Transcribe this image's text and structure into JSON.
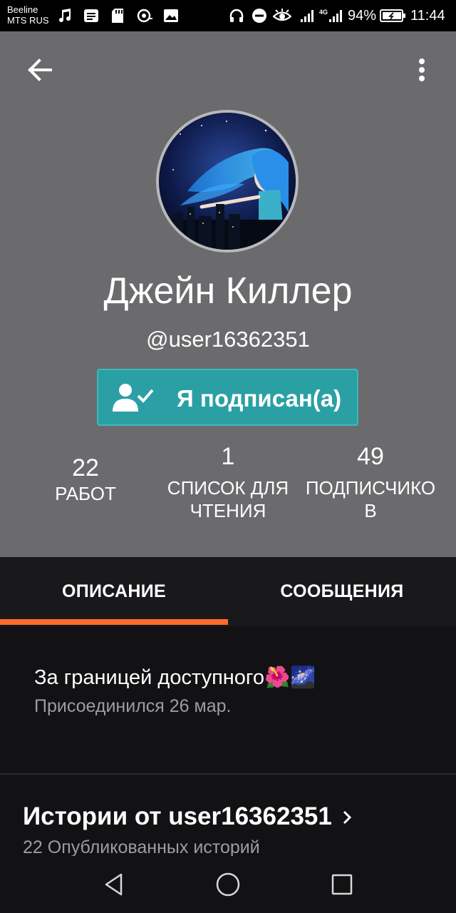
{
  "status_bar": {
    "carrier_line1": "Beeline",
    "carrier_line2": "MTS RUS",
    "battery": "94%",
    "time": "11:44",
    "icons": [
      "music-note-icon",
      "message-icon",
      "sd-card-icon",
      "sync-icon",
      "image-icon",
      "headphones-icon",
      "do-not-disturb-icon",
      "eye-icon",
      "signal-icon",
      "4g-signal-icon",
      "battery-icon"
    ]
  },
  "header": {
    "back_icon": "arrow-left-icon",
    "menu_icon": "more-vert-icon",
    "name": "Джейн Киллер",
    "username": "@user16362351",
    "follow_button": "Я подписан(а)",
    "follow_icon": "person-check-icon"
  },
  "stats": [
    {
      "value": "22",
      "label_line1": "РАБОТ",
      "label_line2": ""
    },
    {
      "value": "1",
      "label_line1": "СПИСОК ДЛЯ",
      "label_line2": "ЧТЕНИЯ"
    },
    {
      "value": "49",
      "label_line1": "ПОДПИСЧИКО",
      "label_line2": "В"
    }
  ],
  "tabs": [
    {
      "label": "ОПИСАНИЕ",
      "active": true
    },
    {
      "label": "СООБЩЕНИЯ",
      "active": false
    }
  ],
  "accent_color": "#ff6b2c",
  "button_color": "#2aa0a4",
  "description": {
    "text": "За границей доступного",
    "emoji": "🌺🌌",
    "joined": "Присоединился 26 мар."
  },
  "stories": {
    "title": "Истории от user16362351",
    "subtitle": "22 Опубликованных историй"
  },
  "navbar": {
    "icons": [
      "back-triangle-icon",
      "home-circle-icon",
      "recents-square-icon"
    ]
  }
}
